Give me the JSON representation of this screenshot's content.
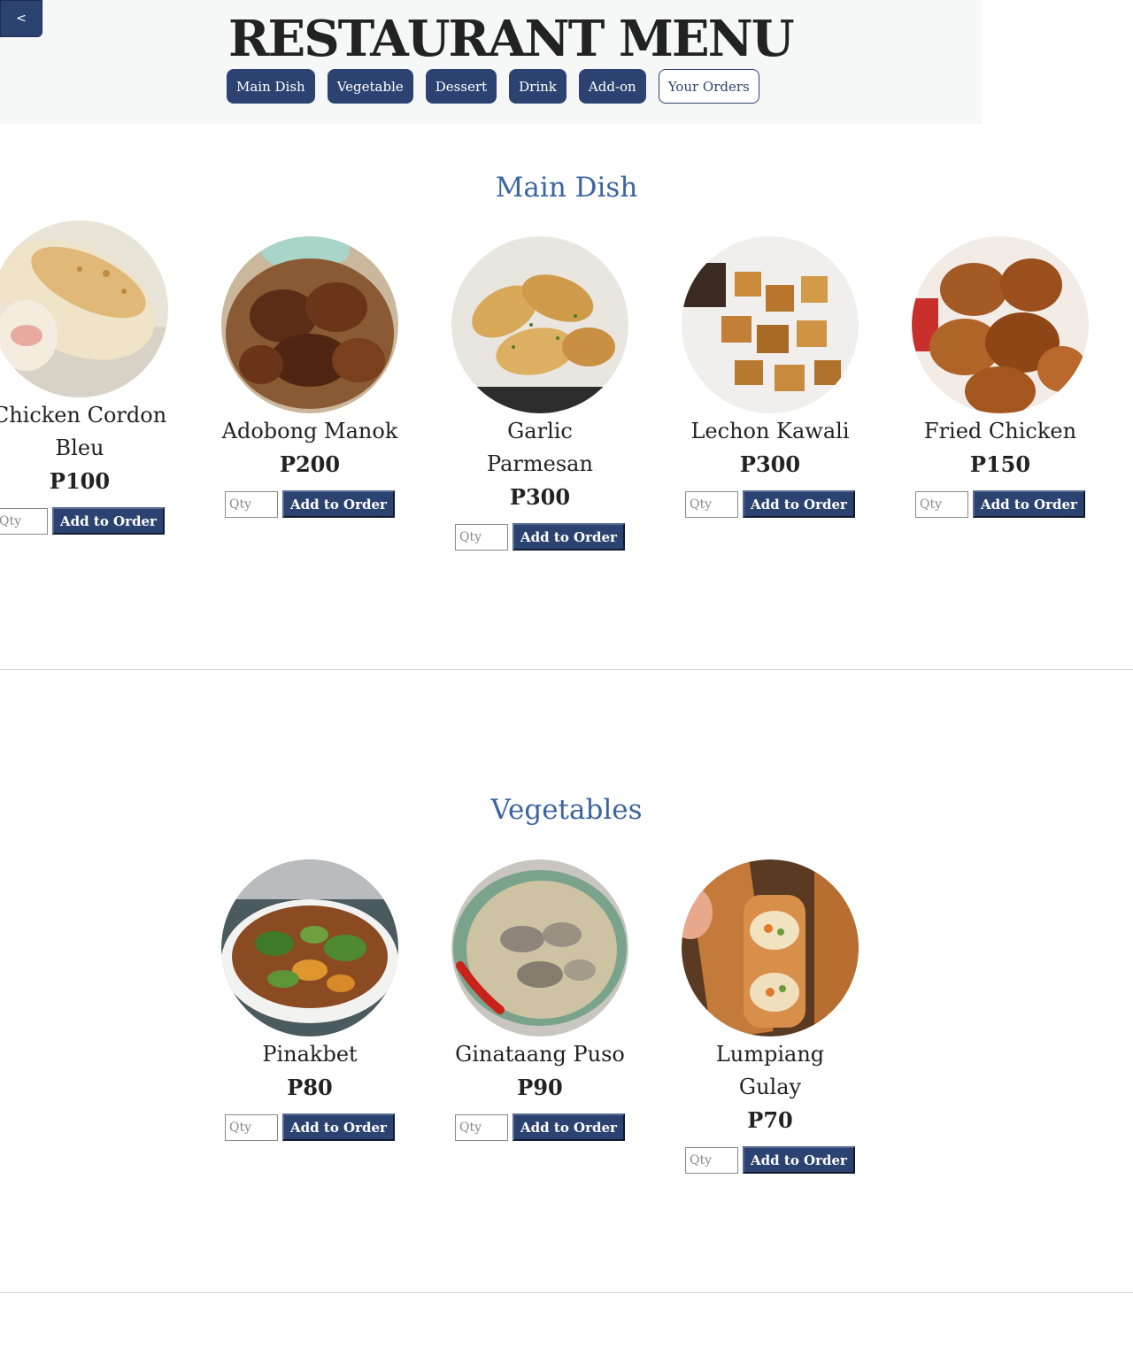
{
  "header": {
    "back_label": "<",
    "title": "RESTAURANT MENU",
    "nav": [
      {
        "label": "Main Dish"
      },
      {
        "label": "Vegetable"
      },
      {
        "label": "Dessert"
      },
      {
        "label": "Drink"
      },
      {
        "label": "Add-on"
      },
      {
        "label": "Your Orders"
      }
    ]
  },
  "sections": [
    {
      "title": "Main Dish",
      "items": [
        {
          "name": "Chicken Cordon Bleu",
          "price": "P100",
          "qty_placeholder": "Qty",
          "button": "Add to Order",
          "image": "chicken-cordon-bleu-photo"
        },
        {
          "name": "Adobong Manok",
          "price": "P200",
          "qty_placeholder": "Qty",
          "button": "Add to Order",
          "image": "adobong-manok-photo"
        },
        {
          "name": "Garlic Parmesan",
          "price": "P300",
          "qty_placeholder": "Qty",
          "button": "Add to Order",
          "image": "garlic-parmesan-photo"
        },
        {
          "name": "Lechon Kawali",
          "price": "P300",
          "qty_placeholder": "Qty",
          "button": "Add to Order",
          "image": "lechon-kawali-photo"
        },
        {
          "name": "Fried Chicken",
          "price": "P150",
          "qty_placeholder": "Qty",
          "button": "Add to Order",
          "image": "fried-chicken-photo"
        }
      ]
    },
    {
      "title": "Vegetables",
      "items": [
        {
          "name": "Pinakbet",
          "price": "P80",
          "qty_placeholder": "Qty",
          "button": "Add to Order",
          "image": "pinakbet-photo"
        },
        {
          "name": "Ginataang Puso",
          "price": "P90",
          "qty_placeholder": "Qty",
          "button": "Add to Order",
          "image": "ginataang-puso-photo"
        },
        {
          "name": "Lumpiang Gulay",
          "price": "P70",
          "qty_placeholder": "Qty",
          "button": "Add to Order",
          "image": "lumpiang-gulay-photo"
        }
      ]
    }
  ],
  "colors": {
    "primary": "#2c4372",
    "section_title": "#3b64a0",
    "header_bg": "#f6f7f7"
  }
}
